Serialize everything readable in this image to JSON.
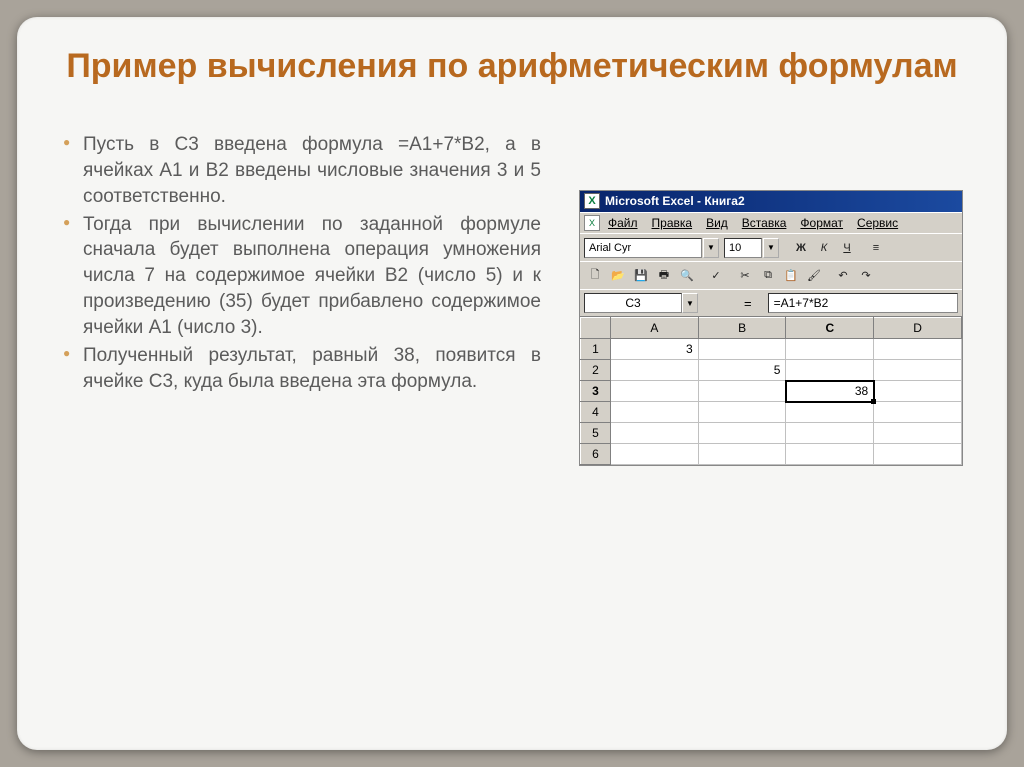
{
  "title": "Пример вычисления по арифметическим формулам",
  "bullets": [
    "Пусть в C3 введена формула =A1+7*B2, а в ячейках A1 и B2 введены числовые значения 3 и 5 соответственно.",
    "Тогда при вычислении по заданной формуле сначала будет выполнена операция умножения числа 7 на содержимое ячейки B2 (число 5) и к произведению (35) будет прибавлено содержимое ячейки A1 (число 3).",
    "Полученный результат, равный 38, появится в ячейке C3, куда была введена эта формула."
  ],
  "excel": {
    "window_title": "Microsoft Excel - Книга2",
    "menu": [
      "Файл",
      "Правка",
      "Вид",
      "Вставка",
      "Формат",
      "Сервис"
    ],
    "font_name": "Arial Cyr",
    "font_size": "10",
    "bold_label": "Ж",
    "italic_label": "К",
    "underline_label": "Ч",
    "name_box": "C3",
    "formula_bar": "=A1+7*B2",
    "columns": [
      "A",
      "B",
      "C",
      "D"
    ],
    "rows": [
      {
        "n": "1",
        "A": "3",
        "B": "",
        "C": "",
        "D": ""
      },
      {
        "n": "2",
        "A": "",
        "B": "5",
        "C": "",
        "D": ""
      },
      {
        "n": "3",
        "A": "",
        "B": "",
        "C": "38",
        "D": ""
      },
      {
        "n": "4",
        "A": "",
        "B": "",
        "C": "",
        "D": ""
      },
      {
        "n": "5",
        "A": "",
        "B": "",
        "C": "",
        "D": ""
      },
      {
        "n": "6",
        "A": "",
        "B": "",
        "C": "",
        "D": ""
      }
    ],
    "selected": {
      "row": 3,
      "col": "C"
    }
  }
}
